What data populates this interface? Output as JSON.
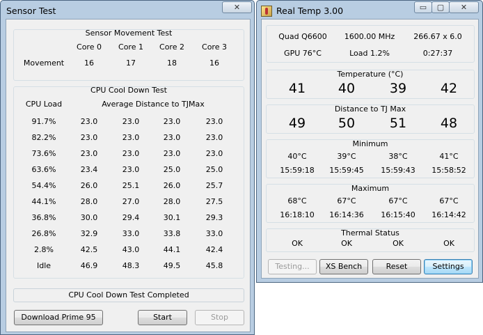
{
  "sensor_window": {
    "title": "Sensor Test",
    "close_glyph": "✕",
    "movement_group": {
      "title": "Sensor Movement Test",
      "headers": [
        "Core 0",
        "Core 1",
        "Core 2",
        "Core 3"
      ],
      "row_label": "Movement",
      "values": [
        "16",
        "17",
        "18",
        "16"
      ]
    },
    "cooldown_group": {
      "title": "CPU Cool Down Test",
      "col1_header": "CPU Load",
      "col2_header": "Average Distance to TJMax",
      "rows": [
        {
          "load": "91.7%",
          "v": [
            "23.0",
            "23.0",
            "23.0",
            "23.0"
          ]
        },
        {
          "load": "82.2%",
          "v": [
            "23.0",
            "23.0",
            "23.0",
            "23.0"
          ]
        },
        {
          "load": "73.6%",
          "v": [
            "23.0",
            "23.0",
            "23.0",
            "23.0"
          ]
        },
        {
          "load": "63.6%",
          "v": [
            "23.4",
            "23.0",
            "25.0",
            "25.0"
          ]
        },
        {
          "load": "54.4%",
          "v": [
            "26.0",
            "25.1",
            "26.0",
            "25.7"
          ]
        },
        {
          "load": "44.1%",
          "v": [
            "28.0",
            "27.0",
            "28.0",
            "27.5"
          ]
        },
        {
          "load": "36.8%",
          "v": [
            "30.0",
            "29.4",
            "30.1",
            "29.3"
          ]
        },
        {
          "load": "26.8%",
          "v": [
            "32.9",
            "33.0",
            "33.8",
            "33.0"
          ]
        },
        {
          "load": "2.8%",
          "v": [
            "42.5",
            "43.0",
            "44.1",
            "42.4"
          ]
        },
        {
          "load": "Idle",
          "v": [
            "46.9",
            "48.3",
            "49.5",
            "45.8"
          ]
        }
      ]
    },
    "status_text": "CPU Cool Down Test Completed",
    "buttons": {
      "download": "Download Prime 95",
      "start": "Start",
      "stop": "Stop"
    }
  },
  "realtemp_window": {
    "title": "Real Temp 3.00",
    "controls": {
      "minimize": "▭",
      "maximize": "▢",
      "close": "✕"
    },
    "info": {
      "cpu": "Quad Q6600",
      "freq": "1600.00 MHz",
      "mult": "266.67 x 6.0",
      "gpu": "GPU  76°C",
      "load": "Load   1.2%",
      "time": "0:27:37"
    },
    "temperature": {
      "title": "Temperature (°C)",
      "values": [
        "41",
        "40",
        "39",
        "42"
      ]
    },
    "distance": {
      "title": "Distance to TJ Max",
      "values": [
        "49",
        "50",
        "51",
        "48"
      ]
    },
    "minimum": {
      "title": "Minimum",
      "temps": [
        "40°C",
        "39°C",
        "38°C",
        "41°C"
      ],
      "times": [
        "15:59:18",
        "15:59:45",
        "15:59:43",
        "15:58:52"
      ]
    },
    "maximum": {
      "title": "Maximum",
      "temps": [
        "68°C",
        "67°C",
        "67°C",
        "67°C"
      ],
      "times": [
        "16:18:10",
        "16:14:36",
        "16:15:40",
        "16:14:42"
      ]
    },
    "thermal": {
      "title": "Thermal Status",
      "values": [
        "OK",
        "OK",
        "OK",
        "OK"
      ]
    },
    "buttons": {
      "testing": "Testing...",
      "xsbench": "XS Bench",
      "reset": "Reset",
      "settings": "Settings"
    }
  }
}
